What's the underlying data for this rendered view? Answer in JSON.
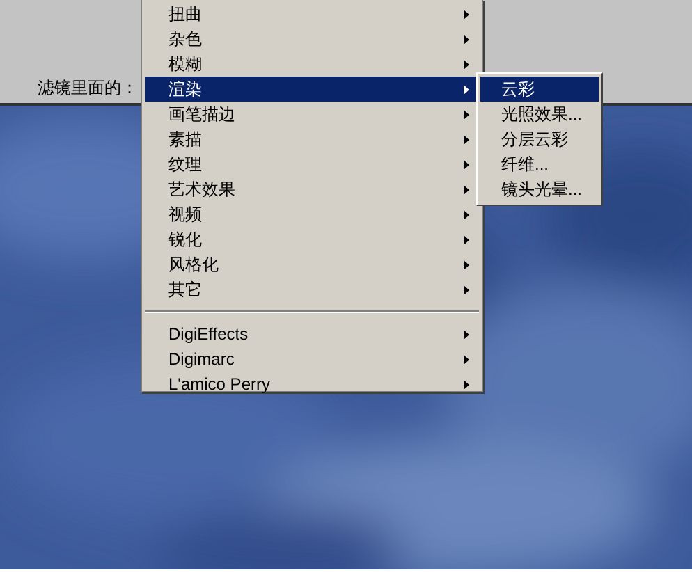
{
  "label": "滤镜里面的：",
  "menu": {
    "items": [
      {
        "kind": "item",
        "label": "扭曲",
        "selected": false,
        "submenu": true
      },
      {
        "kind": "item",
        "label": "杂色",
        "selected": false,
        "submenu": true
      },
      {
        "kind": "item",
        "label": "模糊",
        "selected": false,
        "submenu": true
      },
      {
        "kind": "item",
        "label": "渲染",
        "selected": true,
        "submenu": true
      },
      {
        "kind": "item",
        "label": "画笔描边",
        "selected": false,
        "submenu": true
      },
      {
        "kind": "item",
        "label": "素描",
        "selected": false,
        "submenu": true
      },
      {
        "kind": "item",
        "label": "纹理",
        "selected": false,
        "submenu": true
      },
      {
        "kind": "item",
        "label": "艺术效果",
        "selected": false,
        "submenu": true
      },
      {
        "kind": "item",
        "label": "视频",
        "selected": false,
        "submenu": true
      },
      {
        "kind": "item",
        "label": "锐化",
        "selected": false,
        "submenu": true
      },
      {
        "kind": "item",
        "label": "风格化",
        "selected": false,
        "submenu": true
      },
      {
        "kind": "item",
        "label": "其它",
        "selected": false,
        "submenu": true
      },
      {
        "kind": "separator"
      },
      {
        "kind": "item",
        "label": "DigiEffects",
        "selected": false,
        "submenu": true
      },
      {
        "kind": "item",
        "label": "Digimarc",
        "selected": false,
        "submenu": true
      },
      {
        "kind": "item",
        "label": "L'amico Perry",
        "selected": false,
        "submenu": true
      }
    ]
  },
  "submenu": {
    "items": [
      {
        "label": "云彩",
        "selected": true
      },
      {
        "label": "光照效果...",
        "selected": false
      },
      {
        "label": "分层云彩",
        "selected": false
      },
      {
        "label": "纤维...",
        "selected": false
      },
      {
        "label": "镜头光晕...",
        "selected": false
      }
    ]
  }
}
